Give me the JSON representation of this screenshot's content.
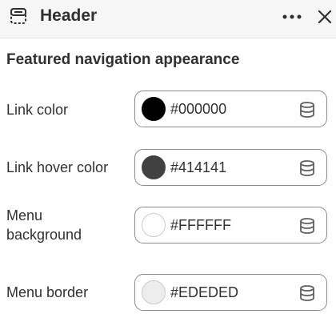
{
  "header": {
    "title": "Header",
    "layout_icon": "layout-section-icon",
    "more_icon": "more-horizontal-icon",
    "close_icon": "close-icon"
  },
  "section": {
    "title": "Featured navigation appearance"
  },
  "settings": [
    {
      "label": "Link color",
      "value": "#000000",
      "swatch": "#000000",
      "icon": "database-icon"
    },
    {
      "label": "Link hover color",
      "value": "#414141",
      "swatch": "#414141",
      "icon": "database-icon"
    },
    {
      "label": "Menu background",
      "value": "#FFFFFF",
      "swatch": "#FFFFFF",
      "icon": "database-icon"
    },
    {
      "label": "Menu border",
      "value": "#EDEDED",
      "swatch": "#EDEDED",
      "icon": "database-icon"
    }
  ],
  "colors": {
    "text": "#303030",
    "header_bg": "#F6F6F7",
    "field_border": "#8A8A8A",
    "icon": "#616161"
  }
}
